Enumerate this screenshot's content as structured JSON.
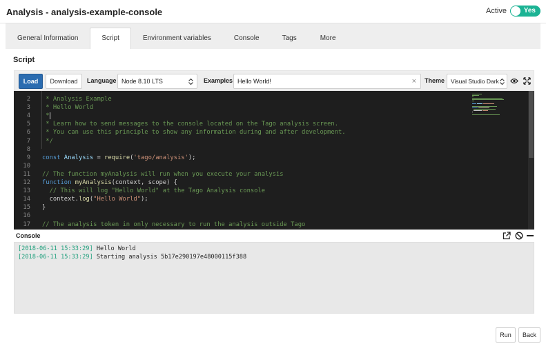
{
  "window": {
    "title": "Analysis - analysis-example-console",
    "active_label": "Active",
    "toggle_label": "Yes"
  },
  "tabs": [
    {
      "label": "General Information"
    },
    {
      "label": "Script"
    },
    {
      "label": "Environment variables"
    },
    {
      "label": "Console"
    },
    {
      "label": "Tags"
    },
    {
      "label": "More"
    }
  ],
  "panel": {
    "title": "Script"
  },
  "toolbar": {
    "load_label": "Load",
    "download_label": "Download",
    "language_label": "Language",
    "language_value": "Node 8.10 LTS",
    "examples_label": "Examples",
    "examples_value": "Hello World!",
    "clear_symbol": "×",
    "theme_label": "Theme",
    "theme_value": "Visual Studio Dark"
  },
  "editor": {
    "lines": [
      {
        "n": "2",
        "parts": [
          {
            "t": " * Analysis Example",
            "c": "comment"
          }
        ]
      },
      {
        "n": "3",
        "parts": [
          {
            "t": " * Hello World",
            "c": "comment"
          }
        ]
      },
      {
        "n": "4",
        "parts": [
          {
            "t": " *",
            "c": "comment"
          }
        ]
      },
      {
        "n": "5",
        "parts": [
          {
            "t": " * Learn how to send messages to the console located on the Tago analysis screen.",
            "c": "comment"
          }
        ]
      },
      {
        "n": "6",
        "parts": [
          {
            "t": " * You can use this principle to show any information during and after development.",
            "c": "comment"
          }
        ]
      },
      {
        "n": "7",
        "parts": [
          {
            "t": " */",
            "c": "comment"
          }
        ]
      },
      {
        "n": "8",
        "parts": []
      },
      {
        "n": "9",
        "parts": [
          {
            "t": "const ",
            "c": "keyword"
          },
          {
            "t": "Analysis",
            "c": "var"
          },
          {
            "t": " = ",
            "c": "plain"
          },
          {
            "t": "require",
            "c": "func"
          },
          {
            "t": "(",
            "c": "plain"
          },
          {
            "t": "'tago/analysis'",
            "c": "string"
          },
          {
            "t": ");",
            "c": "plain"
          }
        ]
      },
      {
        "n": "10",
        "parts": []
      },
      {
        "n": "11",
        "parts": [
          {
            "t": "// The function myAnalysis will run when you execute your analysis",
            "c": "comment"
          }
        ]
      },
      {
        "n": "12",
        "parts": [
          {
            "t": "function ",
            "c": "keyword"
          },
          {
            "t": "myAnalysis",
            "c": "func"
          },
          {
            "t": "(context, scope) {",
            "c": "plain"
          }
        ]
      },
      {
        "n": "13",
        "parts": [
          {
            "t": "  // This will log \"Hello World\" at the Tago Analysis console",
            "c": "comment"
          }
        ]
      },
      {
        "n": "14",
        "parts": [
          {
            "t": "  context.",
            "c": "plain"
          },
          {
            "t": "log",
            "c": "func"
          },
          {
            "t": "(",
            "c": "plain"
          },
          {
            "t": "\"Hello World\"",
            "c": "string"
          },
          {
            "t": ");",
            "c": "plain"
          }
        ]
      },
      {
        "n": "15",
        "parts": [
          {
            "t": "}",
            "c": "plain"
          }
        ]
      },
      {
        "n": "16",
        "parts": []
      },
      {
        "n": "17",
        "parts": [
          {
            "t": "// The analysis token in only necessary to run the analysis outside Tago",
            "c": "comment"
          }
        ]
      }
    ]
  },
  "console": {
    "title": "Console",
    "logs": [
      {
        "timestamp": "[2018-06-11 15:33:29]",
        "message": " Hello World"
      },
      {
        "timestamp": "[2018-06-11 15:33:29]",
        "message": " Starting analysis 5b17e290197e48000115f388"
      }
    ]
  },
  "footer": {
    "run_label": "Run",
    "back_label": "Back"
  },
  "colors": {
    "accent": "#2b6cb0",
    "toggle": "#1bb394",
    "editor_bg": "#1e1e1e",
    "timestamp": "#1b9e7a"
  },
  "icons": {
    "eye": "eye-icon",
    "fullscreen": "expand-icon",
    "popout": "external-link-icon",
    "clear": "ban-icon",
    "minimize": "minus-icon"
  }
}
